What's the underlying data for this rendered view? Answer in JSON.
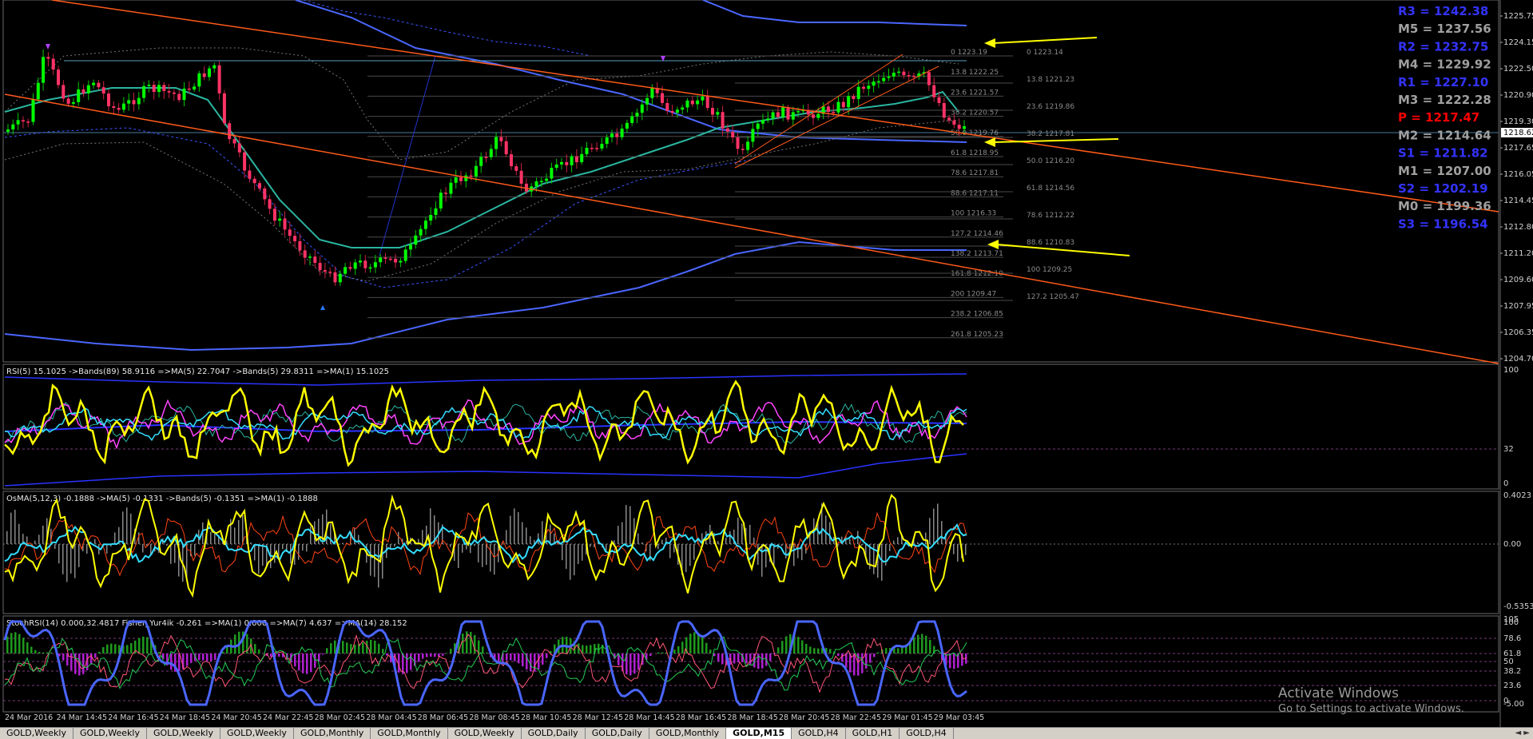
{
  "main_chart": {
    "price_axis_ticks": [
      "1225.75",
      "1224.15",
      "1222.50",
      "1220.90",
      "1219.30",
      "1217.65",
      "1216.05",
      "1214.45",
      "1212.80",
      "1211.20",
      "1209.60",
      "1207.95",
      "1206.35",
      "1204.70"
    ],
    "current_price": "1218.62",
    "pivot_levels": [
      {
        "label": "R3 = 1242.38",
        "color": "#3333ff"
      },
      {
        "label": "M5 = 1237.56",
        "color": "#a0a0a0"
      },
      {
        "label": "R2 = 1232.75",
        "color": "#3333ff"
      },
      {
        "label": "M4 = 1229.92",
        "color": "#a0a0a0"
      },
      {
        "label": "R1 = 1227.10",
        "color": "#3333ff"
      },
      {
        "label": "M3 = 1222.28",
        "color": "#a0a0a0"
      },
      {
        "label": "P   = 1217.47",
        "color": "#ff0000"
      },
      {
        "label": "M2 = 1214.64",
        "color": "#a0a0a0"
      },
      {
        "label": "S1 = 1211.82",
        "color": "#3333ff"
      },
      {
        "label": "M1 = 1207.00",
        "color": "#a0a0a0"
      },
      {
        "label": "S2 = 1202.19",
        "color": "#3333ff"
      },
      {
        "label": "M0 = 1199.36",
        "color": "#a0a0a0"
      },
      {
        "label": "S3 = 1196.54",
        "color": "#3333ff"
      }
    ],
    "fib_levels_a": [
      "0 1223.19",
      "13.8 1222.25",
      "23.6 1221.57",
      "38.2 1220.57",
      "50.0 1219.76",
      "61.8 1218.95",
      "78.6 1217.81",
      "88.6 1217.11",
      "100 1216.33",
      "127.2 1214.46",
      "138.2 1213.71",
      "161.8 1212.10",
      "200 1209.47",
      "238.2 1206.85",
      "261.8 1205.23"
    ],
    "fib_levels_b": [
      "0 1223.14",
      "13.8 1221.23",
      "23.6 1219.86",
      "38.2 1217.81",
      "50.0 1216.20",
      "61.8 1214.56",
      "78.6 1212.22",
      "88.6 1210.83",
      "100 1209.25",
      "127.2 1205.47"
    ]
  },
  "rsi_panel": {
    "label": "RSI(5) 15.1025  ->Bands(89) 58.9116  =>MA(5) 22.7047  ->Bands(5) 29.8311  =>MA(1) 15.1025",
    "ticks": [
      "100",
      "32",
      "0"
    ]
  },
  "osma_panel": {
    "label": "OsMA(5,12,3) -0.1888  ->MA(5) -0.1331  ->Bands(5) -0.1351  =>MA(1) -0.1888",
    "ticks": [
      "0.4023",
      "0.00",
      "-0.5353"
    ]
  },
  "stoch_panel": {
    "label": "StochRSI(14) 0.000,32.4817  Fisher_Yur4ik -0.261  =>MA(1) 0.000  =>MA(7) 4.637  =>MA(14) 28.152",
    "ticks": [
      "105",
      "100",
      "78.6",
      "61.8",
      "50",
      "38.2",
      "23.6",
      "0",
      "-5.00"
    ]
  },
  "time_axis": [
    "24 Mar 2016",
    "24 Mar 14:45",
    "24 Mar 16:45",
    "24 Mar 18:45",
    "24 Mar 20:45",
    "24 Mar 22:45",
    "28 Mar 02:45",
    "28 Mar 04:45",
    "28 Mar 06:45",
    "28 Mar 08:45",
    "28 Mar 10:45",
    "28 Mar 12:45",
    "28 Mar 14:45",
    "28 Mar 16:45",
    "28 Mar 18:45",
    "28 Mar 20:45",
    "28 Mar 22:45",
    "29 Mar 01:45",
    "29 Mar 03:45"
  ],
  "tabs": [
    "GOLD,Weekly",
    "GOLD,Weekly",
    "GOLD,Weekly",
    "GOLD,Weekly",
    "GOLD,Monthly",
    "GOLD,Monthly",
    "GOLD,Weekly",
    "GOLD,Daily",
    "GOLD,Daily",
    "GOLD,Monthly",
    "GOLD,M15",
    "GOLD,H4",
    "GOLD,H1",
    "GOLD,H4"
  ],
  "active_tab_index": 10,
  "tab_scroll": "◄ ►",
  "watermark": {
    "title": "Activate Windows",
    "subtitle": "Go to Settings to activate Windows."
  },
  "colors": {
    "background": "#000000",
    "bull_candle": "#00ff00",
    "bear_candle": "#ff3366",
    "trendline": "#ff5a1a",
    "arrow": "#ffff00",
    "band_blue": "#4a66ff",
    "ma_teal": "#2ab5a0",
    "rsi_line": "#ffff00",
    "grid": "#1c1c1c"
  }
}
